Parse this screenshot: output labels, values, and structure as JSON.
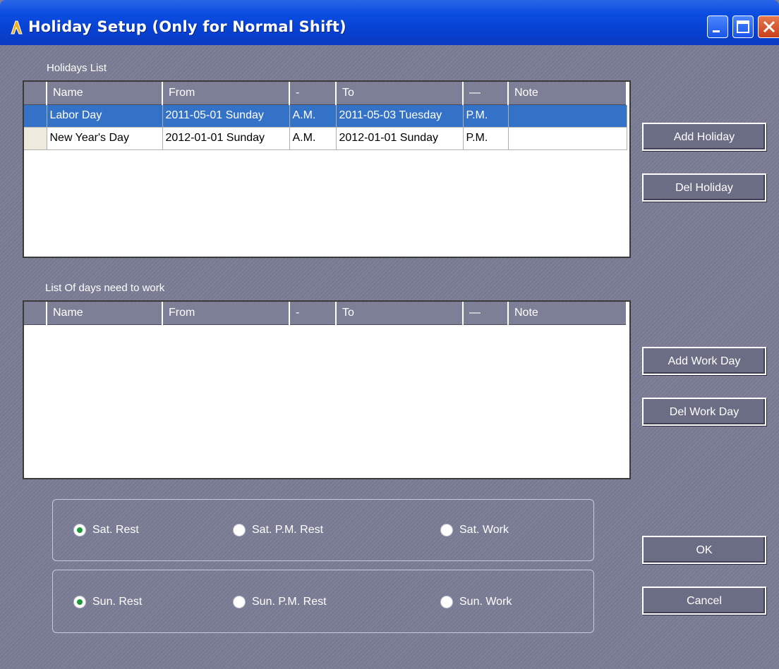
{
  "window": {
    "title": "Holiday Setup (Only for Normal Shift)",
    "controls": [
      "minimize",
      "maximize",
      "close"
    ]
  },
  "holidays": {
    "label": "Holidays List",
    "columns": [
      "Name",
      "From",
      "-",
      "To",
      "—",
      "Note"
    ],
    "rows": [
      {
        "name": "Labor Day",
        "from": "2011-05-01 Sunday",
        "from_half": "A.M.",
        "to": "2011-05-03 Tuesday",
        "to_half": "P.M.",
        "note": "",
        "selected": true
      },
      {
        "name": "New Year's Day",
        "from": "2012-01-01 Sunday",
        "from_half": "A.M.",
        "to": "2012-01-01 Sunday",
        "to_half": "P.M.",
        "note": "",
        "selected": false
      }
    ],
    "add_label": "Add Holiday",
    "del_label": "Del Holiday"
  },
  "workdays": {
    "label": "List Of days need to work",
    "columns": [
      "Name",
      "From",
      "-",
      "To",
      "—",
      "Note"
    ],
    "rows": [],
    "add_label": "Add Work Day",
    "del_label": "Del Work Day"
  },
  "saturday": {
    "options": [
      {
        "label": "Sat. Rest",
        "checked": true
      },
      {
        "label": "Sat.  P.M. Rest",
        "checked": false
      },
      {
        "label": "Sat. Work",
        "checked": false
      }
    ]
  },
  "sunday": {
    "options": [
      {
        "label": "Sun. Rest",
        "checked": true
      },
      {
        "label": "Sun. P.M. Rest",
        "checked": false
      },
      {
        "label": "Sun. Work",
        "checked": false
      }
    ]
  },
  "actions": {
    "ok_label": "OK",
    "cancel_label": "Cancel"
  }
}
